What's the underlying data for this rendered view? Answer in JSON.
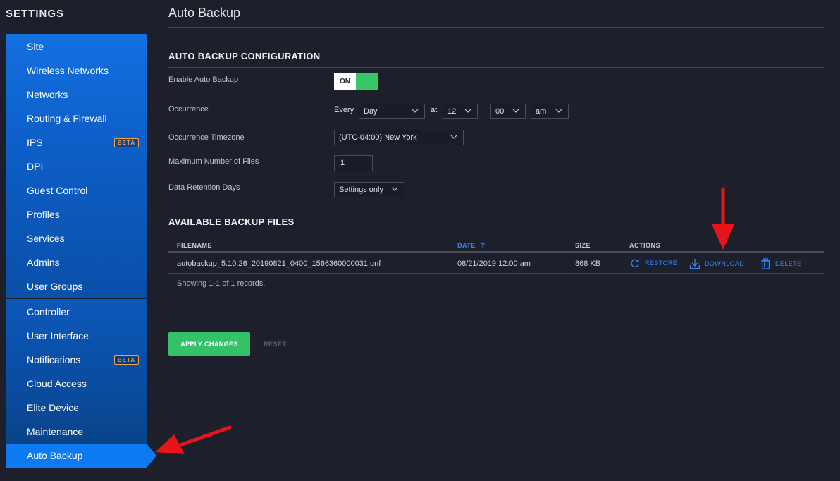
{
  "sidebar": {
    "title": "SETTINGS",
    "group1": [
      {
        "label": "Site"
      },
      {
        "label": "Wireless Networks"
      },
      {
        "label": "Networks"
      },
      {
        "label": "Routing & Firewall"
      },
      {
        "label": "IPS",
        "badge": "BETA"
      },
      {
        "label": "DPI"
      },
      {
        "label": "Guest Control"
      },
      {
        "label": "Profiles"
      },
      {
        "label": "Services"
      },
      {
        "label": "Admins"
      },
      {
        "label": "User Groups"
      }
    ],
    "group2": [
      {
        "label": "Controller"
      },
      {
        "label": "User Interface"
      },
      {
        "label": "Notifications",
        "badge": "BETA"
      },
      {
        "label": "Cloud Access"
      },
      {
        "label": "Elite Device"
      },
      {
        "label": "Maintenance"
      },
      {
        "label": "Auto Backup",
        "active": true
      }
    ]
  },
  "page": {
    "title": "Auto Backup"
  },
  "config": {
    "section_title": "AUTO BACKUP CONFIGURATION",
    "enable_label": "Enable Auto Backup",
    "enable_value": "ON",
    "occurrence_label": "Occurrence",
    "every_text": "Every",
    "frequency": "Day",
    "at_text": "at",
    "hour": "12",
    "colon": ":",
    "minute": "00",
    "ampm": "am",
    "timezone_label": "Occurrence Timezone",
    "timezone": "(UTC-04:00) New York",
    "max_files_label": "Maximum Number of Files",
    "max_files": "1",
    "retention_label": "Data Retention Days",
    "retention": "Settings only"
  },
  "backups": {
    "section_title": "AVAILABLE BACKUP FILES",
    "columns": {
      "filename": "FILENAME",
      "date": "DATE",
      "size": "SIZE",
      "actions": "ACTIONS"
    },
    "rows": [
      {
        "filename": "autobackup_5.10.26_20190821_0400_1566360000031.unf",
        "date": "08/21/2019 12:00 am",
        "size": "868 KB"
      }
    ],
    "actions": {
      "restore": "RESTORE",
      "download": "DOWNLOAD",
      "delete": "DELETE"
    },
    "records_text": "Showing 1-1 of 1 records."
  },
  "footer": {
    "apply_label": "APPLY CHANGES",
    "reset_label": "RESET"
  },
  "colors": {
    "sidebar_blue": "#0d5fc9",
    "active_blue": "#0e7af2",
    "link_blue": "#2f8cff",
    "toggle_green": "#38c766",
    "apply_green": "#35c16a",
    "badge_orange": "#f0a347",
    "annotation_red": "#e8141a"
  },
  "icons": {
    "restore": "refresh-icon",
    "download": "download-icon",
    "delete": "trash-icon",
    "sort": "sort-asc-icon",
    "dropdown": "chevron-down-icon"
  }
}
